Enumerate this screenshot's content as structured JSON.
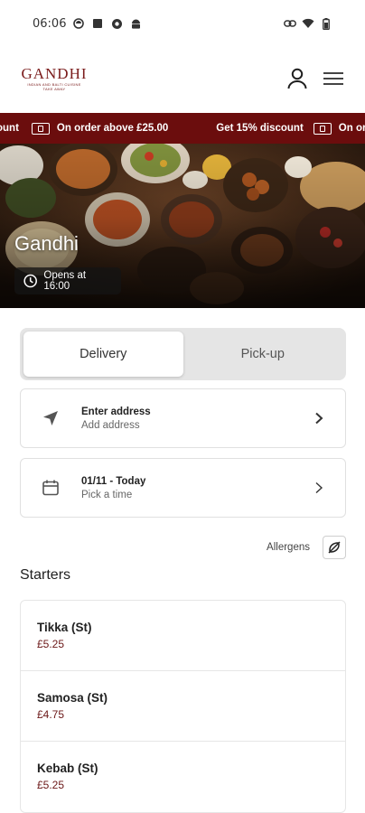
{
  "status_bar": {
    "time": "06:06",
    "left_icons": [
      "media-icon",
      "square-icon",
      "settings-icon",
      "android-icon"
    ],
    "right_icons": [
      "link-icon",
      "wifi-icon",
      "battery-icon"
    ]
  },
  "header": {
    "logo_title": "GANDHI",
    "logo_subtitle_1": "INDIAN AND BALTI CUISINE",
    "logo_subtitle_2": "TAKE AWAY",
    "account_icon": "account-icon",
    "menu_icon": "hamburger-menu-icon"
  },
  "promo": {
    "items": [
      {
        "text": "ount",
        "icon": ""
      },
      {
        "text": "On order above £25.00",
        "icon": "ticket-icon"
      },
      {
        "text": "Get 15% discount",
        "icon": ""
      },
      {
        "text": "On order a",
        "icon": "ticket-icon"
      }
    ],
    "background": "#6b0d0d"
  },
  "hero": {
    "title": "Gandhi",
    "opens_text": "Opens at 16:00",
    "clock_icon": "clock-icon"
  },
  "order_mode": {
    "options": [
      "Delivery",
      "Pick-up"
    ],
    "selected": "Delivery"
  },
  "address_card": {
    "title": "Enter address",
    "subtitle": "Add address",
    "icon": "navigation-arrow-icon"
  },
  "time_card": {
    "title": "01/11 - Today",
    "subtitle": "Pick a time",
    "icon": "calendar-icon"
  },
  "allergens": {
    "label": "Allergens",
    "icon": "allergens-icon"
  },
  "menu": {
    "section_title": "Starters",
    "items": [
      {
        "name": "Tikka (St)",
        "price": "£5.25"
      },
      {
        "name": "Samosa (St)",
        "price": "£4.75"
      },
      {
        "name": "Kebab (St)",
        "price": "£5.25"
      }
    ]
  },
  "colors": {
    "brand": "#6b0d0d",
    "price": "#6b1717"
  }
}
